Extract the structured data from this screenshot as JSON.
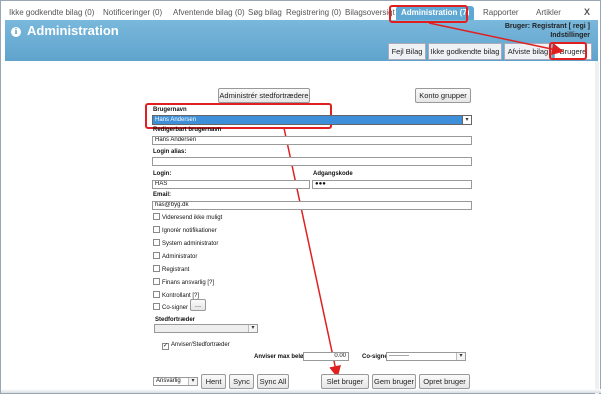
{
  "top_tabs": [
    {
      "label": "Ikke godkendte bilag (0)"
    },
    {
      "label": "Notificeringer (0)"
    },
    {
      "label": "Afventende bilag (0)"
    },
    {
      "label": "Søg bilag"
    },
    {
      "label": "Registrering (0)"
    },
    {
      "label": "Bilagsoversigt"
    },
    {
      "label": "Administration (7)"
    },
    {
      "label": "Rapporter"
    },
    {
      "label": "Artikler"
    }
  ],
  "close_label": "X",
  "header": {
    "title": "Administration",
    "info_icon": "i",
    "user_line": "Bruger: Registrant [ regi ]",
    "settings_link": "Indstillinger"
  },
  "subtabs": [
    {
      "label": "Fejl Bilag"
    },
    {
      "label": "Ikke godkendte bilag"
    },
    {
      "label": "Afviste bilag"
    },
    {
      "label": "Brugere"
    }
  ],
  "actions": {
    "admin_substitutes": "Administrér stedfortrædere",
    "account_groups": "Konto grupper"
  },
  "form": {
    "username_label": "Brugernavn",
    "username_value": "Hans Andersen",
    "editable_username_label": "Redigerbart brugernavn",
    "editable_username_value": "Hans Andersen",
    "login_alias_label": "Login alias:",
    "login_alias_value": "",
    "login_label": "Login:",
    "login_value": "HAS",
    "password_label": "Adgangskode",
    "password_value": "●●●",
    "email_label": "Email:",
    "email_value": "has@byg.dk",
    "checkboxes": [
      {
        "label": "Videresend ikke muligt"
      },
      {
        "label": "Ignorér notifikationer"
      },
      {
        "label": "System administrator"
      },
      {
        "label": "Administrator"
      },
      {
        "label": "Registrant"
      },
      {
        "label": "Finans ansvarlig [?]"
      },
      {
        "label": "Kontrollant [?]"
      },
      {
        "label": "Co-signer"
      }
    ],
    "cosigner_more": "...",
    "substitute_label": "Stedfortræder",
    "substitute_value": "",
    "approver_label": "Anviser/Stedfortræder",
    "approver_check": "✓",
    "max_amount_label": "Anviser max beløb:",
    "max_amount_value": "0.00",
    "cosigner_label": "Co-signer",
    "cosigner_value": "----------"
  },
  "bottom": {
    "role_select": "Ansvarlig",
    "hent": "Hent",
    "sync": "Sync",
    "sync_all": "Sync All",
    "delete_user": "Slet bruger",
    "save_user": "Gem bruger",
    "create_user": "Opret bruger"
  },
  "colors": {
    "header_blue": "#5fa3cc",
    "annotation_red": "#e02020",
    "selection_blue": "#3c8fd8"
  }
}
